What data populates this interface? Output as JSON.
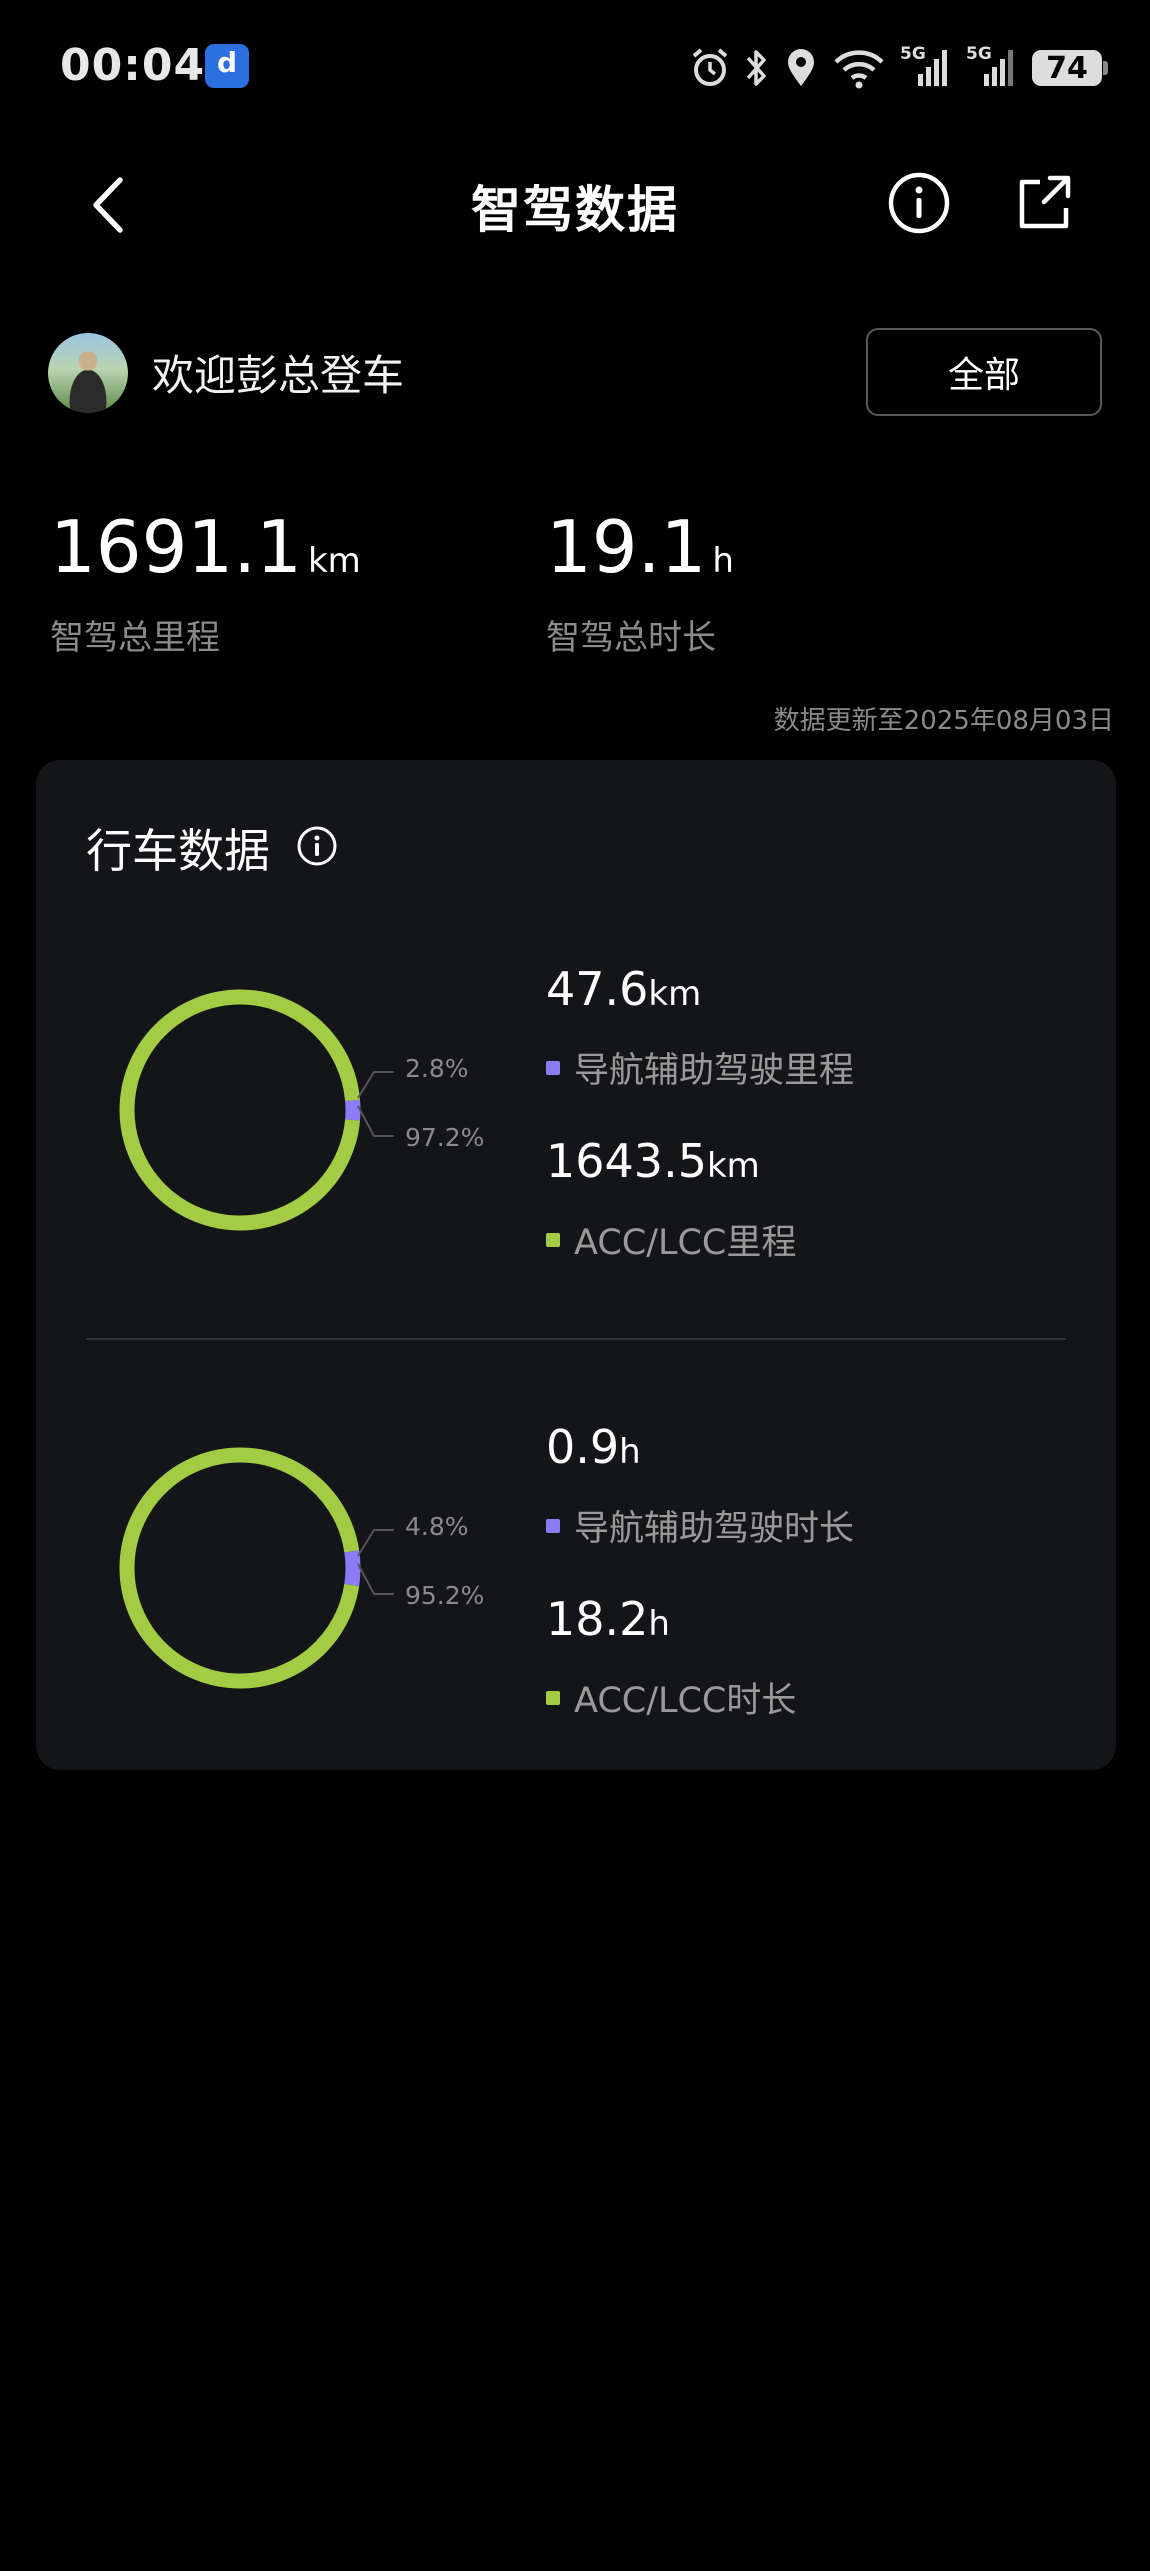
{
  "status_bar": {
    "time": "00:04",
    "battery": "74",
    "network_labels": [
      "5G",
      "5G"
    ],
    "icons": [
      "alarm-icon",
      "bluetooth-icon",
      "location-icon",
      "wifi-icon",
      "signal-icon",
      "signal-icon",
      "battery-icon"
    ]
  },
  "nav": {
    "title": "智驾数据",
    "icons": [
      "back-icon",
      "info-icon",
      "share-icon"
    ]
  },
  "user": {
    "welcome": "欢迎彭总登车",
    "filter_label": "全部"
  },
  "summary": {
    "total_distance": {
      "value": "1691.1",
      "unit": "km",
      "label": "智驾总里程"
    },
    "total_duration": {
      "value": "19.1",
      "unit": "h",
      "label": "智驾总时长"
    },
    "updated": "数据更新至2025年08月03日"
  },
  "driving_data": {
    "title": "行车数据",
    "distance": {
      "nav_pct": "2.8%",
      "acc_pct": "97.2%",
      "nav": {
        "value": "47.6",
        "unit": "km",
        "label": "导航辅助驾驶里程"
      },
      "acc": {
        "value": "1643.5",
        "unit": "km",
        "label": "ACC/LCC里程"
      }
    },
    "duration": {
      "nav_pct": "4.8%",
      "acc_pct": "95.2%",
      "nav": {
        "value": "0.9",
        "unit": "h",
        "label": "导航辅助驾驶时长"
      },
      "acc": {
        "value": "18.2",
        "unit": "h",
        "label": "ACC/LCC时长"
      }
    }
  },
  "colors": {
    "nav_assist": "#8b7cf6",
    "acc_lcc": "#a3cc45",
    "card_bg": "#141518"
  },
  "chart_data": [
    {
      "type": "pie",
      "categories": [
        "导航辅助驾驶里程",
        "ACC/LCC里程"
      ],
      "values": [
        2.8,
        97.2
      ],
      "colors": [
        "#8b7cf6",
        "#a3cc45"
      ]
    },
    {
      "type": "pie",
      "categories": [
        "导航辅助驾驶时长",
        "ACC/LCC时长"
      ],
      "values": [
        4.8,
        95.2
      ],
      "colors": [
        "#8b7cf6",
        "#a3cc45"
      ]
    }
  ]
}
